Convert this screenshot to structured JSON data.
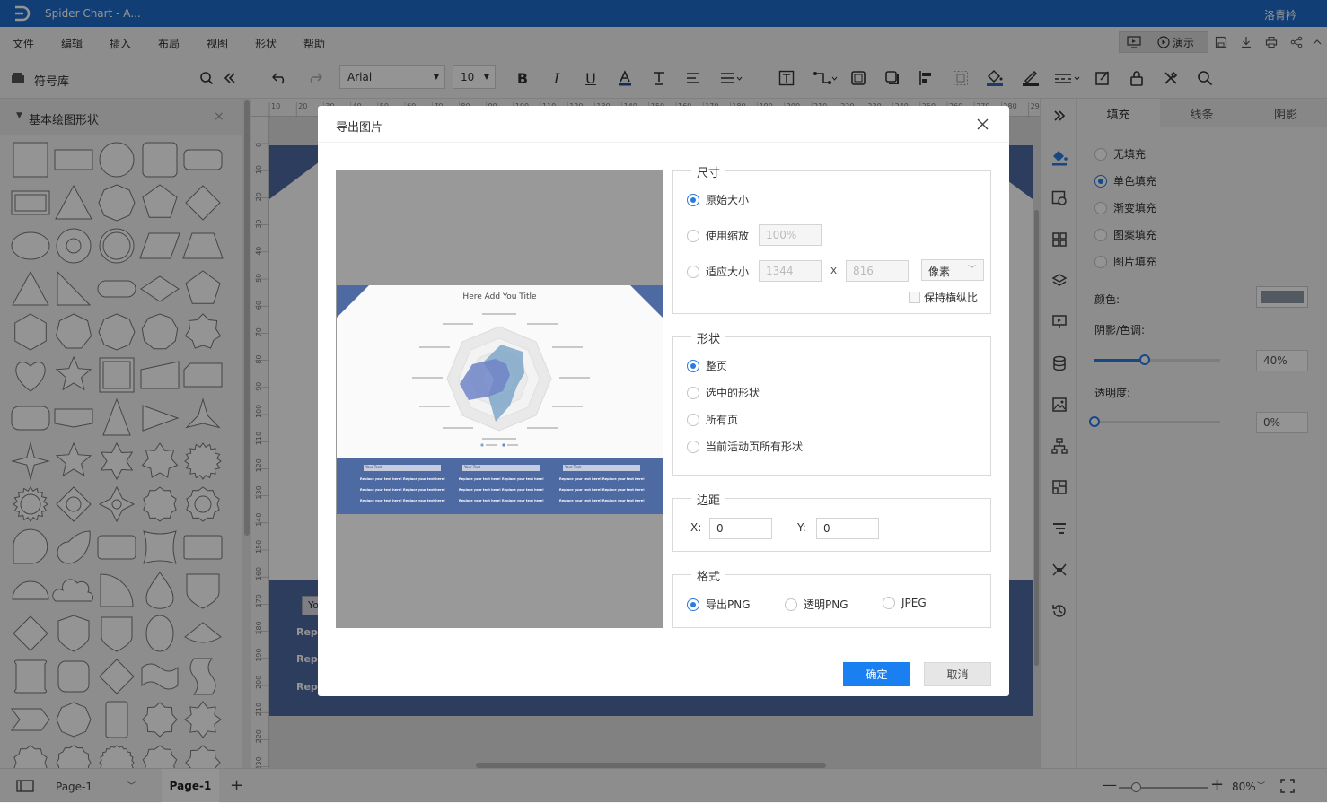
{
  "app": {
    "title": "Spider Chart - A...",
    "user": "洛青衿"
  },
  "menu": [
    "文件",
    "编辑",
    "插入",
    "布局",
    "视图",
    "形状",
    "帮助"
  ],
  "topbar": {
    "present_label": "演示"
  },
  "toolbar": {
    "font": "Arial",
    "size": "10"
  },
  "library": {
    "title": "符号库",
    "section": "基本绘图形状"
  },
  "ruler_top": [
    "10",
    "20",
    "30",
    "40",
    "50",
    "60",
    "70",
    "80",
    "90",
    "100",
    "110",
    "120",
    "130",
    "140",
    "150",
    "160",
    "170",
    "180",
    "190",
    "200",
    "210",
    "220",
    "230",
    "240",
    "250",
    "260",
    "270",
    "280",
    "290"
  ],
  "ruler_left": [
    "0",
    "10",
    "20",
    "30",
    "40",
    "50",
    "60",
    "70",
    "80",
    "90",
    "100",
    "110",
    "120",
    "130",
    "140",
    "150",
    "160",
    "170",
    "180",
    "190",
    "200",
    "210",
    "220",
    "230"
  ],
  "canvas": {
    "peek_input": "Yo",
    "peek_text": [
      "Repl",
      "Repl",
      "Repl"
    ]
  },
  "dialog": {
    "title": "导出图片",
    "preview": {
      "title": "Here Add You Title",
      "table_header": [
        "Your Text",
        "Your Text",
        "Your Text"
      ],
      "table_cell": "Replace your text here!"
    },
    "size": {
      "legend": "尺寸",
      "options": [
        "原始大小",
        "使用缩放",
        "适应大小"
      ],
      "selected": 0,
      "scale_value": "100%",
      "width_value": "1344",
      "x_sep": "x",
      "height_value": "816",
      "unit": "像素",
      "keep_ratio": "保持横纵比"
    },
    "shape": {
      "legend": "形状",
      "options": [
        "整页",
        "选中的形状",
        "所有页",
        "当前活动页所有形状"
      ],
      "selected": 0
    },
    "margin": {
      "legend": "边距",
      "x_label": "X:",
      "x_value": "0",
      "y_label": "Y:",
      "y_value": "0"
    },
    "format": {
      "legend": "格式",
      "options": [
        "导出PNG",
        "透明PNG",
        "JPEG"
      ],
      "selected": 0
    },
    "ok": "确定",
    "cancel": "取消"
  },
  "right_panel": {
    "tabs": [
      "填充",
      "线条",
      "阴影"
    ],
    "fill_options": [
      "无填充",
      "单色填充",
      "渐变填充",
      "图案填充",
      "图片填充"
    ],
    "fill_selected": 1,
    "color_label": "颜色:",
    "shade_label": "阴影/色调:",
    "shade_value": "40%",
    "shade_fraction": 0.4,
    "opacity_label": "透明度:",
    "opacity_value": "0%",
    "opacity_fraction": 0,
    "swatch_color": "#8f9aa5"
  },
  "status": {
    "page_name": "Page-1",
    "page_tab": "Page-1",
    "zoom": "80%"
  },
  "colors": {
    "brand": "#1e6cc8",
    "accent": "#2a7ae2",
    "ok_button": "#1a7ff0"
  }
}
